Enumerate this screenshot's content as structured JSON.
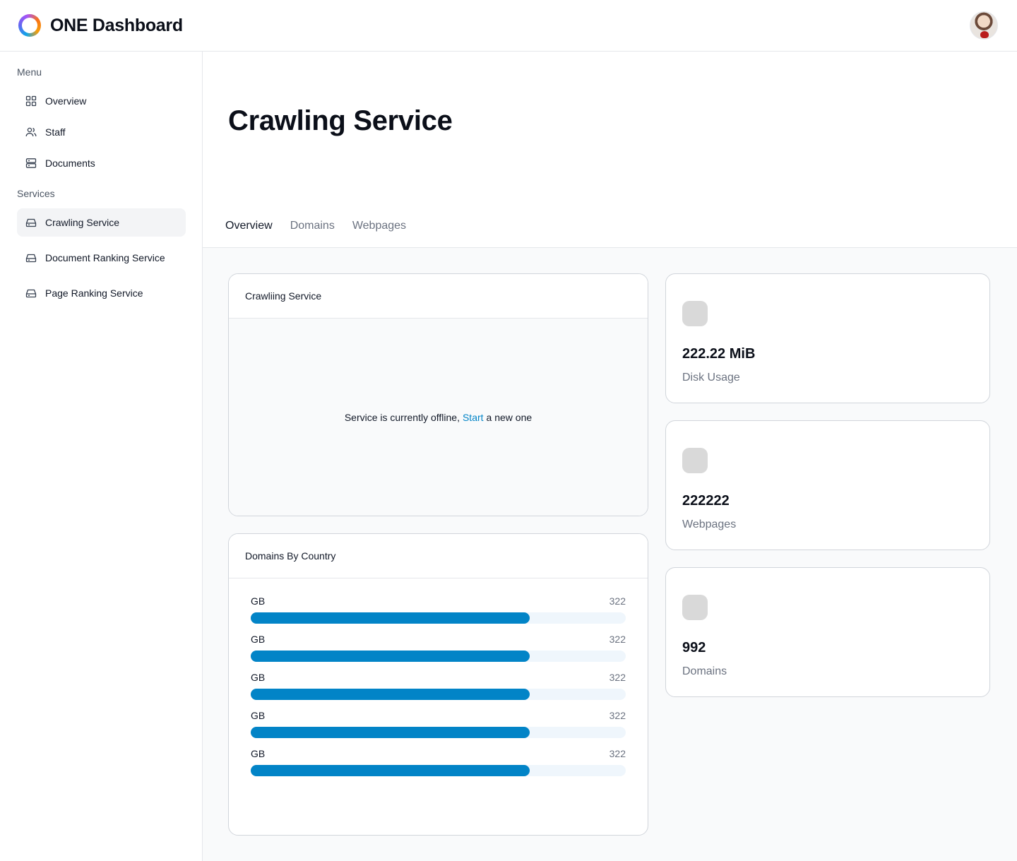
{
  "header": {
    "app_title": "ONE Dashboard",
    "avatar_alt": "user avatar"
  },
  "sidebar": {
    "menu_label": "Menu",
    "menu_items": [
      {
        "label": "Overview",
        "icon": "grid-icon"
      },
      {
        "label": "Staff",
        "icon": "users-icon"
      },
      {
        "label": "Documents",
        "icon": "server-icon"
      }
    ],
    "services_label": "Services",
    "service_items": [
      {
        "label": "Crawling Service",
        "icon": "drive-icon",
        "active": true
      },
      {
        "label": "Document Ranking Service",
        "icon": "drive-icon",
        "active": false
      },
      {
        "label": "Page Ranking Service",
        "icon": "drive-icon",
        "active": false
      }
    ]
  },
  "main": {
    "title": "Crawling Service",
    "tabs": [
      {
        "label": "Overview",
        "active": true
      },
      {
        "label": "Domains",
        "active": false
      },
      {
        "label": "Webpages",
        "active": false
      }
    ],
    "service_card": {
      "title": "Crawliing Service",
      "message_prefix": "Service is currently offline,",
      "start_link": "Start",
      "message_suffix": "a new one"
    },
    "domains_card": {
      "title": "Domains By Country",
      "rows": [
        {
          "label": "GB",
          "value": "322",
          "fraction": 0.744
        },
        {
          "label": "GB",
          "value": "322",
          "fraction": 0.744
        },
        {
          "label": "GB",
          "value": "322",
          "fraction": 0.744
        },
        {
          "label": "GB",
          "value": "322",
          "fraction": 0.744
        },
        {
          "label": "GB",
          "value": "322",
          "fraction": 0.744
        }
      ]
    },
    "stats": [
      {
        "value": "222.22 MiB",
        "label": "Disk Usage"
      },
      {
        "value": "222222",
        "label": "Webpages"
      },
      {
        "value": "992",
        "label": "Domains"
      }
    ]
  },
  "colors": {
    "accent": "#0284c7",
    "bar_track": "#eff6fc",
    "active_nav_bg": "#f3f4f6"
  }
}
